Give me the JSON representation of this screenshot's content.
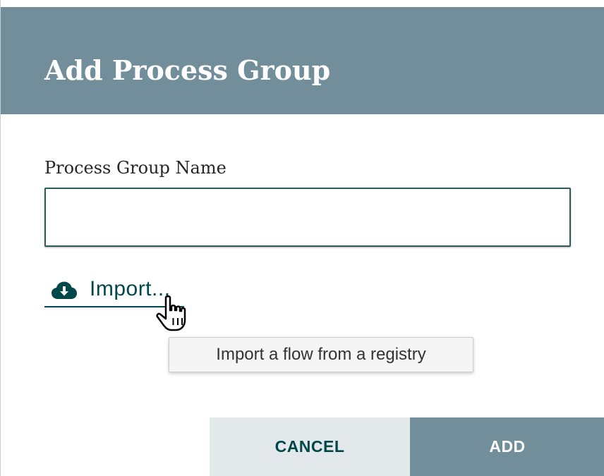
{
  "dialog": {
    "title": "Add Process Group"
  },
  "form": {
    "name_label": "Process Group Name",
    "name_value": "",
    "name_placeholder": ""
  },
  "import_link": {
    "icon": "cloud-download-icon",
    "label": "Import..."
  },
  "tooltip": {
    "text": "Import a flow from a registry"
  },
  "cursor": {
    "icon": "hand-pointer-cursor-icon"
  },
  "buttons": {
    "cancel_label": "CANCEL",
    "add_label": "ADD"
  },
  "colors": {
    "header_bg": "#728e9b",
    "header_text": "#ffffff",
    "accent": "#004849",
    "cancel_bg": "#e3e8eb",
    "add_bg": "#728e9b",
    "tooltip_bg": "#f5f5f5"
  }
}
